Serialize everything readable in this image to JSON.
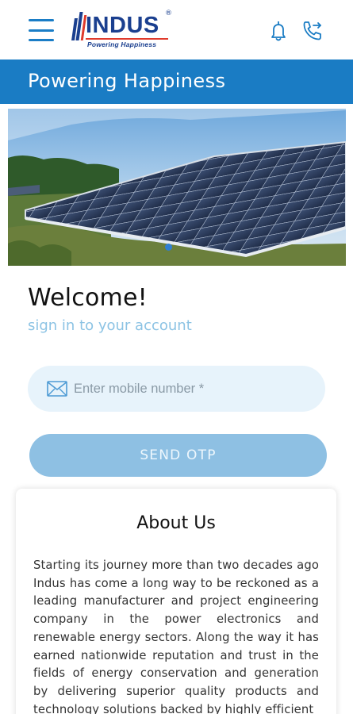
{
  "header": {
    "logo_text": "INDUS",
    "logo_registered": "®",
    "logo_tagline": "Powering Happiness"
  },
  "banner": {
    "title": "Powering Happiness"
  },
  "hero": {
    "alt": "solar-panels-photo",
    "active_slide": 1
  },
  "login": {
    "welcome": "Welcome!",
    "subtitle": "sign in to your account",
    "mobile_placeholder": "Enter mobile number *",
    "send_otp_label": "SEND OTP"
  },
  "about": {
    "title": "About Us",
    "text": "Starting its journey more than two decades ago Indus has come a long way to be reckoned as a leading manufacturer and project engineering company in the power electronics and renewable energy sectors. Along the way it has earned nationwide reputation and trust in the fields of energy conservation and generation by delivering superior quality products and technology solutions backed by highly efficient"
  },
  "colors": {
    "brand_blue": "#1a7cc4",
    "logo_navy": "#1a3f8f",
    "logo_red": "#e03a2b",
    "button_blue": "#8ec0e3",
    "input_bg": "#e7f3fb"
  },
  "icons": [
    "menu-icon",
    "bell-icon",
    "phone-forward-icon",
    "mail-icon"
  ]
}
